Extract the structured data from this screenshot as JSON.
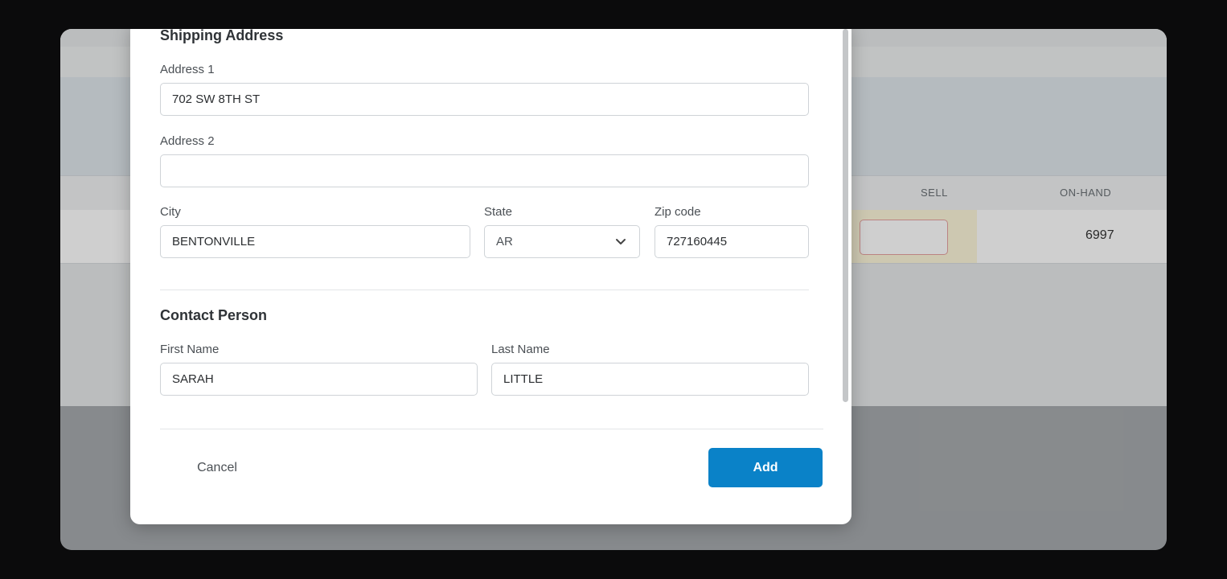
{
  "background_table": {
    "columns": [
      "SELL",
      "ON-HAND"
    ],
    "row": {
      "sell": "",
      "on_hand": "6997"
    }
  },
  "modal": {
    "shipping_title": "Shipping Address",
    "address1": {
      "label": "Address 1",
      "value": "702 SW 8TH ST"
    },
    "address2": {
      "label": "Address 2",
      "value": ""
    },
    "city": {
      "label": "City",
      "value": "BENTONVILLE"
    },
    "state": {
      "label": "State",
      "value": "AR"
    },
    "zip": {
      "label": "Zip code",
      "value": "727160445"
    },
    "contact_title": "Contact Person",
    "first_name": {
      "label": "First Name",
      "value": "SARAH"
    },
    "last_name": {
      "label": "Last Name",
      "value": "LITTLE"
    },
    "cancel_label": "Cancel",
    "add_label": "Add"
  },
  "colors": {
    "primary_button": "#0a82c8",
    "sell_highlight": "#fdf7da",
    "invalid_border": "#e7a2a0"
  },
  "icons": {
    "state_dropdown": "chevron-down-icon"
  }
}
